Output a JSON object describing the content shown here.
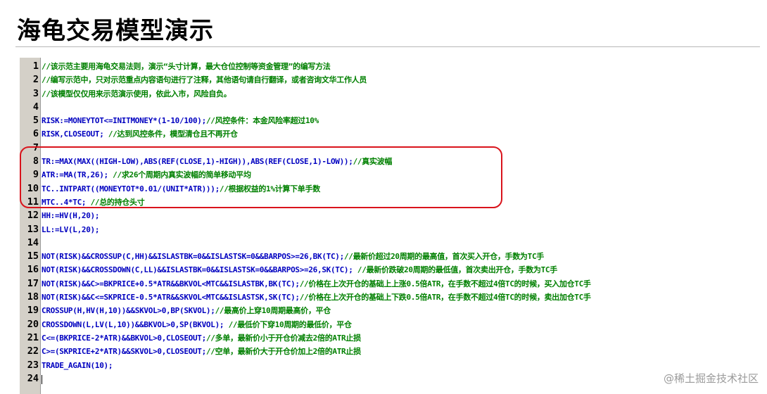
{
  "title": "海龟交易模型演示",
  "watermark": "@稀土掘金技术社区",
  "lines": [
    {
      "num": "1",
      "code": "",
      "comment": "//该示范主要用海龟交易法则，演示“头寸计算，最大仓位控制等资金管理”的编写方法"
    },
    {
      "num": "2",
      "code": "",
      "comment": "//编写示范中，只对示范重点内容语句进行了注释，其他语句请自行翻译，或者咨询文华工作人员"
    },
    {
      "num": "3",
      "code": "",
      "comment": "//该模型仅仅用来示范演示使用，依此入市，风险自负。"
    },
    {
      "num": "4",
      "code": "",
      "comment": ""
    },
    {
      "num": "5",
      "code": "RISK:=MONEYTOT<=INITMONEY*(1-10/100);",
      "comment": "//风控条件：本金风险率超过10%"
    },
    {
      "num": "6",
      "code": "RISK,CLOSEOUT; ",
      "comment": "//达到风控条件，模型清仓且不再开仓"
    },
    {
      "num": "7",
      "code": "",
      "comment": ""
    },
    {
      "num": "8",
      "code": "TR:=MAX(MAX((HIGH-LOW),ABS(REF(CLOSE,1)-HIGH)),ABS(REF(CLOSE,1)-LOW));",
      "comment": "//真实波幅"
    },
    {
      "num": "9",
      "code": "ATR:=MA(TR,26); ",
      "comment": "//求26个周期内真实波幅的简单移动平均"
    },
    {
      "num": "10",
      "code": "TC..INTPART((MONEYTOT*0.01/(UNIT*ATR)));",
      "comment": "//根据权益的1%计算下单手数"
    },
    {
      "num": "11",
      "code": "MTC..4*TC; ",
      "comment": "//总的持仓头寸"
    },
    {
      "num": "12",
      "code": "HH:=HV(H,20);",
      "comment": ""
    },
    {
      "num": "13",
      "code": "LL:=LV(L,20);",
      "comment": ""
    },
    {
      "num": "14",
      "code": "",
      "comment": ""
    },
    {
      "num": "15",
      "code": "NOT(RISK)&&CROSSUP(C,HH)&&ISLASTBK=0&&ISLASTSK=0&&BARPOS>=26,BK(TC);",
      "comment": "//最新价超过20周期的最高值，首次买入开仓，手数为TC手"
    },
    {
      "num": "16",
      "code": "NOT(RISK)&&CROSSDOWN(C,LL)&&ISLASTBK=0&&ISLASTSK=0&&BARPOS>=26,SK(TC); ",
      "comment": "//最新价跌破20周期的最低值，首次卖出开仓，手数为TC手"
    },
    {
      "num": "17",
      "code": "NOT(RISK)&&C>=BKPRICE+0.5*ATR&&BKVOL<MTC&&ISLASTBK,BK(TC);",
      "comment": "//价格在上次开仓的基础上上涨0.5倍ATR，在手数不超过4倍TC的时候，买入加仓TC手"
    },
    {
      "num": "18",
      "code": "NOT(RISK)&&C<=SKPRICE-0.5*ATR&&SKVOL<MTC&&ISLASTSK,SK(TC);",
      "comment": "//价格在上次开仓的基础上下跌0.5倍ATR，在手数不超过4倍TC的时候，卖出加仓TC手"
    },
    {
      "num": "19",
      "code": "CROSSUP(H,HV(H,10))&&SKVOL>0,BP(SKVOL);",
      "comment": "//最高价上穿10周期最高价，平仓"
    },
    {
      "num": "20",
      "code": "CROSSDOWN(L,LV(L,10))&&BKVOL>0,SP(BKVOL); ",
      "comment": "//最低价下穿10周期的最低价，平仓"
    },
    {
      "num": "21",
      "code": "C<=(BKPRICE-2*ATR)&&BKVOL>0,CLOSEOUT;",
      "comment": "//多单，最新价小于开仓价减去2倍的ATR止损"
    },
    {
      "num": "22",
      "code": "C>=(SKPRICE+2*ATR)&&SKVOL>0,CLOSEOUT;",
      "comment": "//空单，最新价大于开仓价加上2倍的ATR止损"
    },
    {
      "num": "23",
      "code": "TRADE_AGAIN(10);",
      "comment": ""
    },
    {
      "num": "24",
      "code": "",
      "comment": ""
    }
  ]
}
